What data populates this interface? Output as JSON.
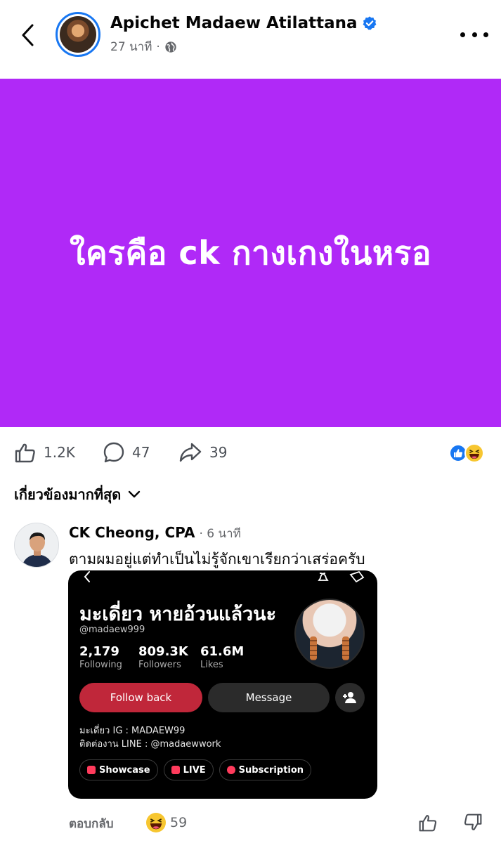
{
  "header": {
    "author_name": "Apichet Madaew Atilattana",
    "time_ago": "27 นาที",
    "separator": "·"
  },
  "post": {
    "text": "ใครคือ ck กางเกงในหรอ",
    "background_color": "#b029f7"
  },
  "actions": {
    "like_count": "1.2K",
    "comment_count": "47",
    "share_count": "39"
  },
  "sort": {
    "label": "เกี่ยวข้องมากที่สุด"
  },
  "comment": {
    "author": "CK Cheong, CPA",
    "time_ago": "· 6 นาที",
    "text": "ตามผมอยู่แต่ทำเป็นไม่รู้จักเขาเรียกว่าเสร่อครับ",
    "reply_label": "ตอบกลับ",
    "reaction_count": "59"
  },
  "embedded_profile": {
    "display_name": "มะเดี่ยว หายอ้วนแล้วนะ",
    "handle": "@madaew999",
    "stats": [
      {
        "value": "2,179",
        "label": "Following"
      },
      {
        "value": "809.3K",
        "label": "Followers"
      },
      {
        "value": "61.6M",
        "label": "Likes"
      }
    ],
    "follow_button": "Follow back",
    "message_button": "Message",
    "bio_lines": [
      "มะเดี่ยว IG : MADAEW99",
      "ติดต่องาน LINE : @madaewwork"
    ],
    "chips": [
      {
        "label": "Showcase",
        "color": "#ff3b5c"
      },
      {
        "label": "LIVE",
        "color": "#ff3b5c"
      },
      {
        "label": "Subscription",
        "color": "#ff3b5c"
      }
    ]
  },
  "colors": {
    "accent_blue": "#1877f2",
    "follow_red": "#c0273a"
  }
}
